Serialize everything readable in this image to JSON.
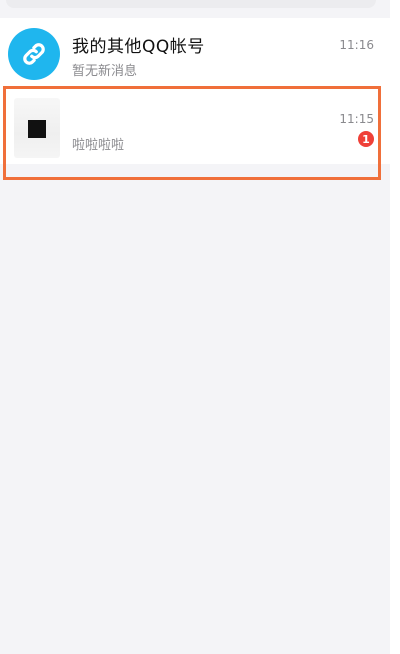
{
  "conversations": [
    {
      "title": "我的其他QQ帐号",
      "preview": "暂无新消息",
      "time": "11:16",
      "avatar_icon": "link-icon",
      "avatar_color": "#1fb6ee"
    },
    {
      "title": "",
      "preview": "啦啦啦啦",
      "time": "11:15",
      "unread_count": "1",
      "badge_color": "#ef4038"
    }
  ],
  "highlight_color": "#f06f3a"
}
